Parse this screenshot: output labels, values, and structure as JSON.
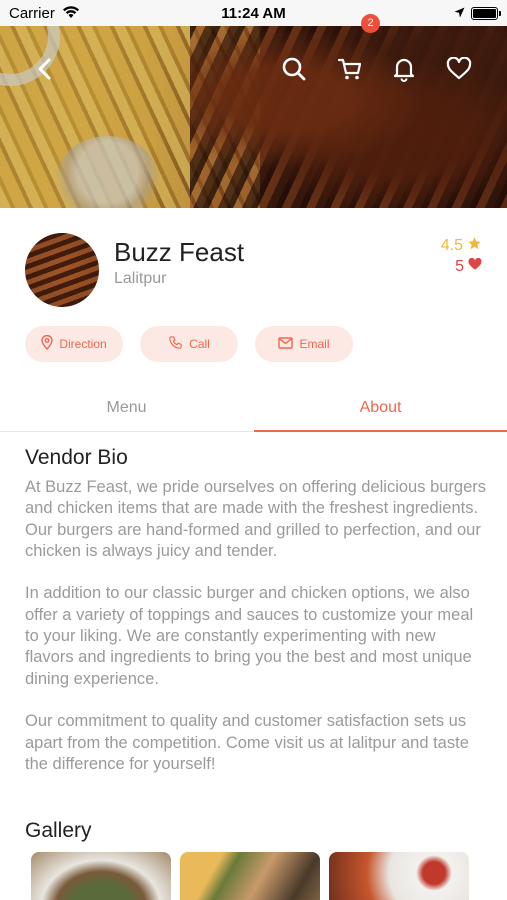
{
  "status_bar": {
    "carrier": "Carrier",
    "time": "11:24 AM",
    "battery_level": 1.0
  },
  "header": {
    "cart_count": "2",
    "icons": [
      "back-icon",
      "search-icon",
      "cart-icon",
      "bell-icon",
      "heart-icon"
    ]
  },
  "vendor": {
    "name": "Buzz Feast",
    "location": "Lalitpur",
    "rating": "4.5",
    "likes": "5"
  },
  "actions": {
    "direction": "Direction",
    "call": "Call",
    "email": "Email"
  },
  "tabs": [
    {
      "label": "Menu",
      "active": false
    },
    {
      "label": "About",
      "active": true
    }
  ],
  "about": {
    "bio_title": "Vendor Bio",
    "paragraphs": [
      "At Buzz Feast, we pride ourselves on offering delicious burgers and chicken items that are made with the freshest ingredients. Our burgers are hand-formed and grilled to perfection, and our chicken is always juicy and tender.",
      "In addition to our classic burger and chicken options, we also offer a variety of toppings and sauces to customize your meal to your liking. We are constantly experimenting with new flavors and ingredients to bring you the best and most unique dining experience.",
      "Our commitment to quality and customer satisfaction sets us apart from the competition. Come visit us at lalitpur and taste the difference for yourself!"
    ],
    "gallery_title": "Gallery"
  },
  "colors": {
    "accent": "#f0664e",
    "accent_light": "#fde9e4",
    "badge": "#ef4e3b",
    "star": "#f0b93a",
    "heart": "#e04545",
    "muted_text": "#9a9a9a"
  }
}
